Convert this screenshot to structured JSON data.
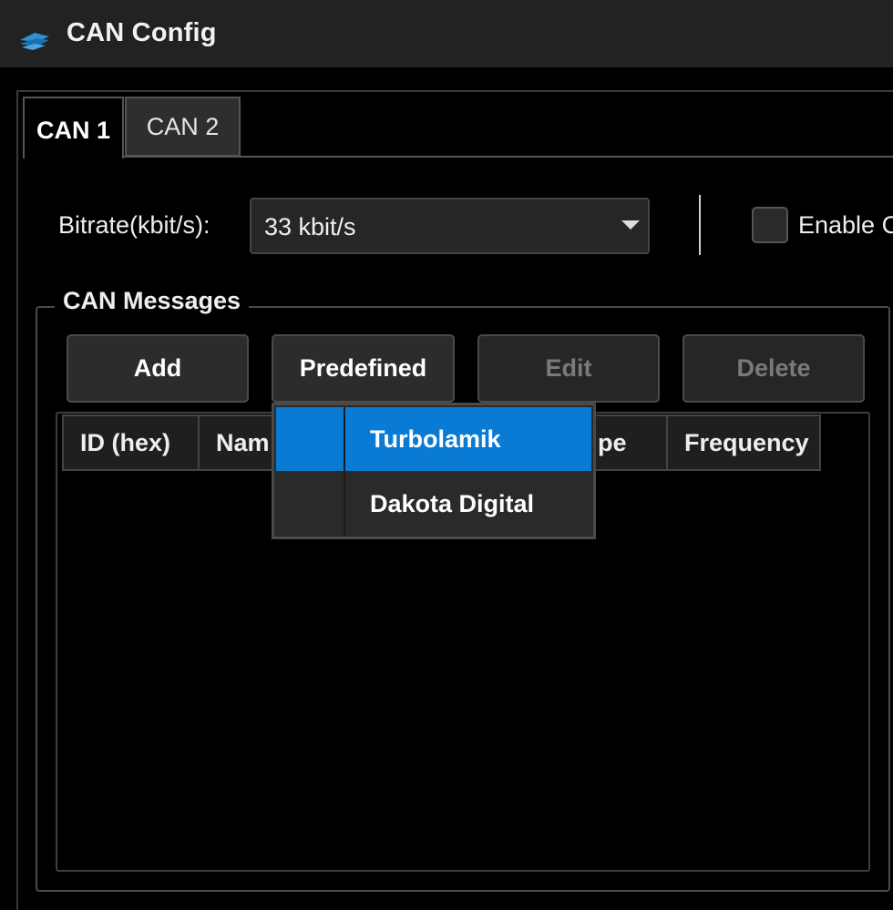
{
  "window": {
    "title": "CAN Config",
    "icon": "app-logo-icon"
  },
  "tabs": [
    {
      "label": "CAN 1",
      "selected": true
    },
    {
      "label": "CAN 2",
      "selected": false
    }
  ],
  "settings": {
    "bitrate_label": "Bitrate(kbit/s):",
    "bitrate_value": "33 kbit/s",
    "enable_label": "Enable C",
    "enable_checked": false
  },
  "messages": {
    "group_title": "CAN Messages",
    "buttons": {
      "add": "Add",
      "predefined": "Predefined",
      "edit": "Edit",
      "delete": "Delete"
    },
    "columns": [
      "ID (hex)",
      "Nam",
      "pe",
      "Frequency"
    ],
    "rows": []
  },
  "predefined_menu": {
    "items": [
      {
        "label": "Turbolamik",
        "highlighted": true
      },
      {
        "label": "Dakota Digital",
        "highlighted": false
      }
    ]
  },
  "colors": {
    "accent": "#0a7bd4",
    "titlebar": "#222222",
    "background": "#000000"
  }
}
